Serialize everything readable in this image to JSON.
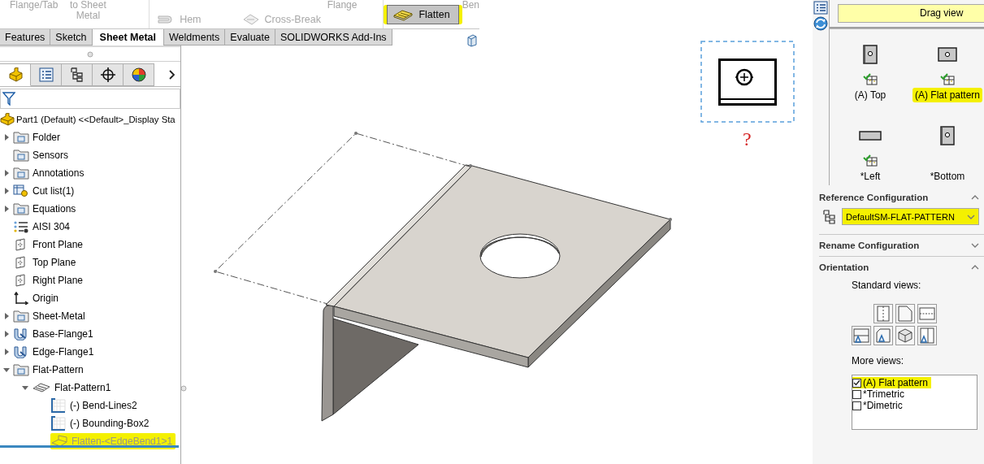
{
  "ribbon": {
    "groups": [
      {
        "captions": [
          "Flange/Tab",
          "to Sheet Metal"
        ]
      },
      {
        "captions": [
          "Flange"
        ],
        "buttons": [
          {
            "label": "Hem",
            "disabled": true,
            "pressed": false,
            "highlighted": false
          },
          {
            "label": "Cross-Break",
            "disabled": true,
            "pressed": false,
            "highlighted": false
          }
        ]
      },
      {
        "captions": [
          "Ben"
        ],
        "buttons": [
          {
            "label": "Flatten",
            "disabled": false,
            "pressed": true,
            "highlighted": true
          }
        ]
      }
    ]
  },
  "command_tabs": [
    {
      "label": "Features",
      "selected": false
    },
    {
      "label": "Sketch",
      "selected": false
    },
    {
      "label": "Sheet Metal",
      "selected": true
    },
    {
      "label": "Weldments",
      "selected": false
    },
    {
      "label": "Evaluate",
      "selected": false
    },
    {
      "label": "SOLIDWORKS Add-Ins",
      "selected": false
    }
  ],
  "manager_tabs": [
    {
      "selected": true
    },
    {
      "selected": false
    },
    {
      "selected": false
    },
    {
      "selected": false
    },
    {
      "selected": false
    }
  ],
  "feature_tree": {
    "items": [
      {
        "label": "Part1 (Default) <<Default>_Display Sta",
        "kind": "part",
        "dimmed": false,
        "highlighted": false,
        "children": [
          {
            "label": "Folder",
            "kind": "folder",
            "expanded": false,
            "dimmed": false,
            "highlighted": false
          },
          {
            "label": "Sensors",
            "kind": "folder",
            "dimmed": false,
            "highlighted": false
          },
          {
            "label": "Annotations",
            "kind": "folder",
            "expanded": false,
            "dimmed": false,
            "highlighted": false
          },
          {
            "label": "Cut list(1)",
            "kind": "cutlist",
            "expanded": false,
            "dimmed": false,
            "highlighted": false
          },
          {
            "label": "Equations",
            "kind": "folder",
            "expanded": false,
            "dimmed": false,
            "highlighted": false
          },
          {
            "label": "AISI 304",
            "kind": "material",
            "dimmed": false,
            "highlighted": false
          },
          {
            "label": "Front Plane",
            "kind": "plane",
            "dimmed": false,
            "highlighted": false
          },
          {
            "label": "Top Plane",
            "kind": "plane",
            "dimmed": false,
            "highlighted": false
          },
          {
            "label": "Right Plane",
            "kind": "plane",
            "dimmed": false,
            "highlighted": false
          },
          {
            "label": "Origin",
            "kind": "origin",
            "dimmed": false,
            "highlighted": false
          },
          {
            "label": "Sheet-Metal",
            "kind": "folder",
            "expanded": false,
            "dimmed": false,
            "highlighted": false
          },
          {
            "label": "Base-Flange1",
            "kind": "feature",
            "expanded": false,
            "dimmed": false,
            "highlighted": false
          },
          {
            "label": "Edge-Flange1",
            "kind": "feature",
            "expanded": false,
            "dimmed": false,
            "highlighted": false
          },
          {
            "label": "Flat-Pattern",
            "kind": "folder",
            "expanded": true,
            "dimmed": false,
            "highlighted": false,
            "children": [
              {
                "label": "Flat-Pattern1",
                "kind": "flat",
                "expanded": true,
                "dimmed": false,
                "highlighted": false,
                "children": [
                  {
                    "label": "(-) Bend-Lines2",
                    "kind": "sketch",
                    "dimmed": false,
                    "highlighted": false
                  },
                  {
                    "label": "(-) Bounding-Box2",
                    "kind": "sketch",
                    "dimmed": false,
                    "highlighted": false
                  },
                  {
                    "label": "Flatten-<EdgeBend1>1",
                    "kind": "bend",
                    "dimmed": true,
                    "highlighted": true
                  }
                ]
              }
            ]
          }
        ]
      }
    ]
  },
  "viewport": {
    "preview_label": "?"
  },
  "property_manager": {
    "banner": "Drag view",
    "views": [
      {
        "label": "(A) Top",
        "kind": "portrait",
        "checked": true,
        "highlighted": false
      },
      {
        "label": "(A) Flat pattern",
        "kind": "landscape",
        "checked": true,
        "highlighted": true
      },
      {
        "label": "*Left",
        "kind": "edge",
        "checked": true,
        "highlighted": false
      },
      {
        "label": "*Bottom",
        "kind": "portrait",
        "checked": false,
        "highlighted": false
      }
    ],
    "reference_configuration": {
      "title": "Reference Configuration",
      "expanded": true,
      "value": "DefaultSM-FLAT-PATTERN",
      "highlighted": true
    },
    "rename_configuration": {
      "title": "Rename Configuration",
      "expanded": false
    },
    "orientation": {
      "title": "Orientation",
      "expanded": true,
      "standard_views_label": "Standard views:",
      "more_views_label": "More views:",
      "more_views": [
        {
          "label": "(A) Flat pattern",
          "checked": true,
          "highlighted": true
        },
        {
          "label": "*Trimetric",
          "checked": false,
          "highlighted": false
        },
        {
          "label": "*Dimetric",
          "checked": false,
          "highlighted": false
        }
      ]
    }
  }
}
